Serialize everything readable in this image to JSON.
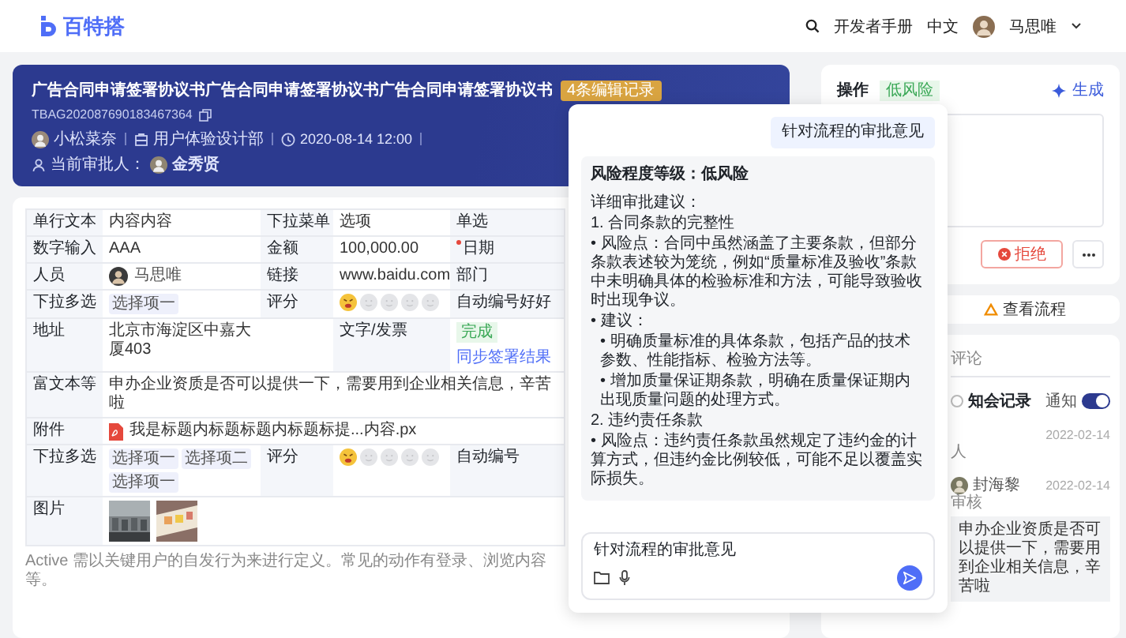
{
  "header": {
    "logo": "百特搭",
    "links": [
      "开发者手册",
      "中文"
    ],
    "user": "马思唯"
  },
  "banner": {
    "title": "广告合同申请签署协议书广告合同申请签署协议书广告合同申请签署协议书",
    "edit_tag": "4条编辑记录",
    "code": "TBAG202087690183467364",
    "owner": "小松菜奈",
    "department": "用户体验设计部",
    "time": "2020-08-14 12:00",
    "approver_label": "当前审批人：",
    "approver": "金秀贤"
  },
  "form": {
    "rows": [
      {
        "kind": "grid",
        "cells": [
          {
            "kind": "label",
            "text": "单行文本",
            "required": false
          },
          {
            "kind": "text",
            "text": "内容内容"
          },
          {
            "kind": "label",
            "text": "下拉菜单",
            "required": false
          },
          {
            "kind": "text",
            "text": "选项"
          },
          {
            "kind": "label",
            "text": "单选",
            "required": false
          }
        ]
      },
      {
        "kind": "grid",
        "cells": [
          {
            "kind": "label",
            "text": "数字输入",
            "required": false
          },
          {
            "kind": "text",
            "text": "AAA"
          },
          {
            "kind": "label",
            "text": "金额",
            "required": false
          },
          {
            "kind": "text",
            "text": "100,000.00"
          },
          {
            "kind": "label",
            "text": "日期",
            "required": true
          }
        ]
      },
      {
        "kind": "grid",
        "cells": [
          {
            "kind": "label",
            "text": "人员",
            "required": false
          },
          {
            "kind": "person",
            "text": "马思唯"
          },
          {
            "kind": "label",
            "text": "链接",
            "required": false
          },
          {
            "kind": "text",
            "text": "www.baidu.com"
          },
          {
            "kind": "label",
            "text": "部门",
            "required": false
          }
        ]
      },
      {
        "kind": "grid",
        "cells": [
          {
            "kind": "label",
            "text": "下拉多选",
            "required": false
          },
          {
            "kind": "tags",
            "tags": [
              "选择项一"
            ]
          },
          {
            "kind": "label",
            "text": "评分",
            "required": false
          },
          {
            "kind": "rating",
            "stars": 1
          },
          {
            "kind": "label",
            "text": "自动编号好好",
            "required": false
          }
        ]
      },
      {
        "kind": "grid",
        "cells": [
          {
            "kind": "label",
            "text": "地址",
            "required": false
          },
          {
            "kind": "text",
            "text": "北京市海淀区中嘉大厦403"
          },
          {
            "kind": "empty"
          },
          {
            "kind": "label",
            "text": "文字/发票",
            "required": false
          },
          {
            "kind": "status",
            "status": "完成",
            "link": "同步签署结果"
          }
        ]
      },
      {
        "kind": "tall",
        "cells": [
          {
            "kind": "label",
            "text": "富文本等",
            "required": false
          },
          {
            "kind": "text",
            "text": "申办企业资质是否可以提供一下，需要用到企业相关信息，辛苦啦"
          }
        ]
      },
      {
        "kind": "full",
        "cells": [
          {
            "kind": "label",
            "text": "附件",
            "required": false
          },
          {
            "kind": "file",
            "text": "我是标题内标题标题内标题标提...内容.px"
          }
        ]
      },
      {
        "kind": "grid",
        "cells": [
          {
            "kind": "label",
            "text": "下拉多选",
            "required": false
          },
          {
            "kind": "tags",
            "tags": [
              "选择项一",
              "选择项二",
              "选择项一"
            ]
          },
          {
            "kind": "label",
            "text": "评分",
            "required": false
          },
          {
            "kind": "rating",
            "stars": 1
          },
          {
            "kind": "label",
            "text": "自动编号",
            "required": false
          }
        ]
      },
      {
        "kind": "full",
        "cells": [
          {
            "kind": "label",
            "text": "图片",
            "required": false
          },
          {
            "kind": "images"
          }
        ]
      }
    ],
    "footer": "Active 需以关键用户的自发行为来进行定义。常见的动作有登录、浏览内容等。"
  },
  "chat": {
    "question": "针对流程的审批意见",
    "answer": [
      {
        "kind": "heading",
        "text": "风险程度等级：低风险"
      },
      {
        "kind": "text",
        "text": "详细审批建议："
      },
      {
        "kind": "text",
        "text": "1. 合同条款的完整性"
      },
      {
        "kind": "bullet",
        "text": "• 风险点：合同中虽然涵盖了主要条款，但部分条款表述较为笼统，例如“质量标准及验收”条款中未明确具体的检验标准和方法，可能导致验收时出现争议。"
      },
      {
        "kind": "bullet",
        "text": "• 建议："
      },
      {
        "kind": "subbullet",
        "text": "• 明确质量标准的具体条款，包括产品的技术参数、性能指标、检验方法等。"
      },
      {
        "kind": "subbullet",
        "text": "• 增加质量保证期条款，明确在质量保证期内出现质量问题的处理方式。"
      },
      {
        "kind": "text",
        "text": "2. 违约责任条款"
      },
      {
        "kind": "bullet",
        "text": "• 风险点：违约责任条款虽然规定了违约金的计算方式，但违约金比例较低，可能不足以覆盖实际损失。"
      }
    ],
    "input": {
      "value": "针对流程的审批意见"
    }
  },
  "actions": {
    "title": "操作",
    "risk": "低风险",
    "generate": "生成",
    "reject": "拒绝"
  },
  "flow_link": "查看流程",
  "comments": {
    "tab": {
      "label": "评论",
      "selected": false
    },
    "filter": {
      "label": "知会记录",
      "checked": false
    },
    "notify": {
      "label": "通知",
      "on": true
    },
    "entries": [
      {
        "date": "2022-02-14",
        "note": "人"
      },
      {
        "author": "封海黎",
        "date": "2022-02-14",
        "note": "审核",
        "comment": "申办企业资质是否可以提供一下，需要用到企业相关信息，辛苦啦"
      }
    ]
  }
}
